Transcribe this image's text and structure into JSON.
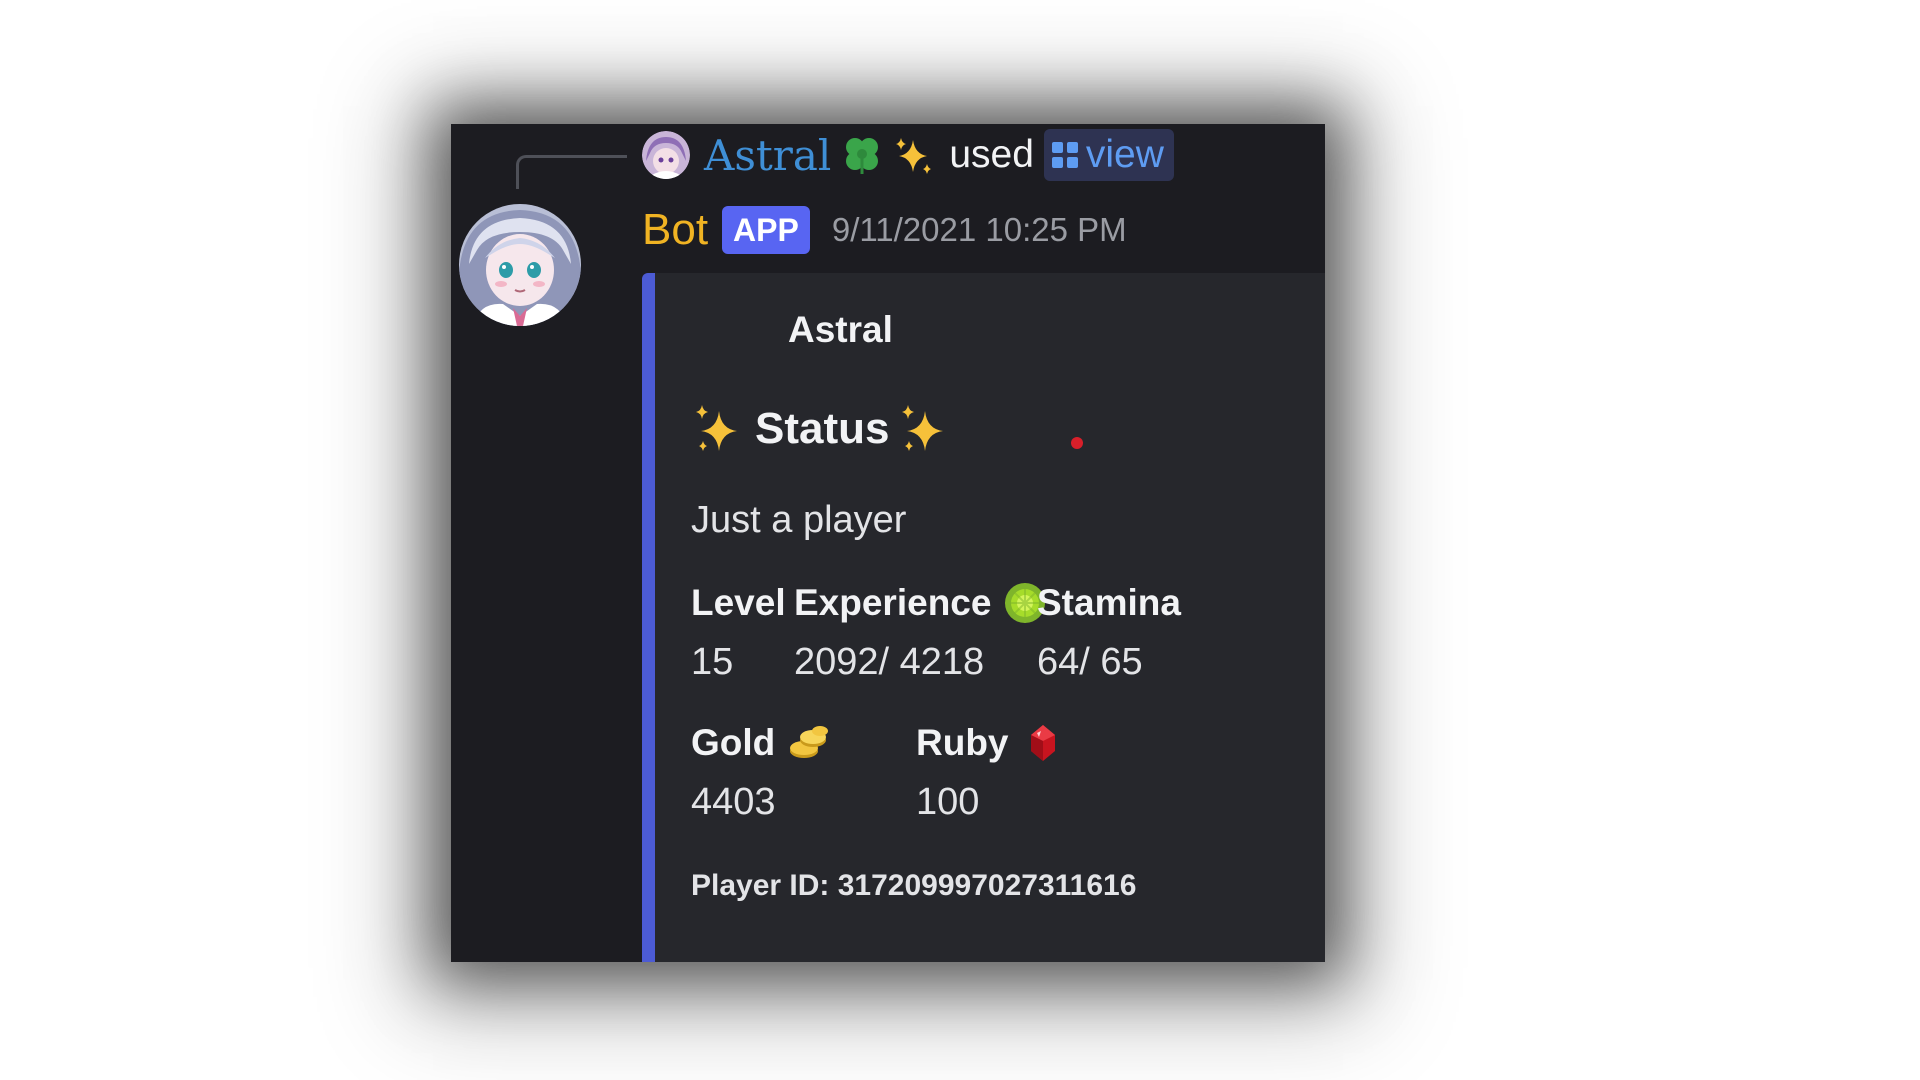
{
  "reply": {
    "username": "Astral",
    "clover_emoji": "four-leaf-clover-icon",
    "sparkle_emoji": "sparkles-icon",
    "used_text": "used",
    "command_label": "view",
    "command_icon": "app-command-icon"
  },
  "message": {
    "author": "Bot",
    "badge": "APP",
    "timestamp": "9/11/2021 10:25 PM"
  },
  "embed": {
    "author": "Astral",
    "title": "Status",
    "description": "Just a player",
    "accent_color": "#4c5bd4",
    "fields": [
      {
        "name": "Level",
        "value": "15"
      },
      {
        "name": "Experience",
        "value": "2092/ 4218",
        "icon": "experience-orb-icon"
      },
      {
        "name": "Stamina",
        "value": "64/ 65"
      },
      {
        "name": "Gold",
        "value": "4403",
        "icon": "gold-coins-icon"
      },
      {
        "name": "Ruby",
        "value": "100",
        "icon": "ruby-gem-icon"
      }
    ],
    "footer": "Player ID: 317209997027311616"
  },
  "colors": {
    "background": "#1c1c21",
    "embed_background": "#26272c",
    "bot_name": "#f0b323",
    "reply_name": "#3f8fd6",
    "app_badge": "#5865f2",
    "command_link": "#5e9cf2"
  }
}
